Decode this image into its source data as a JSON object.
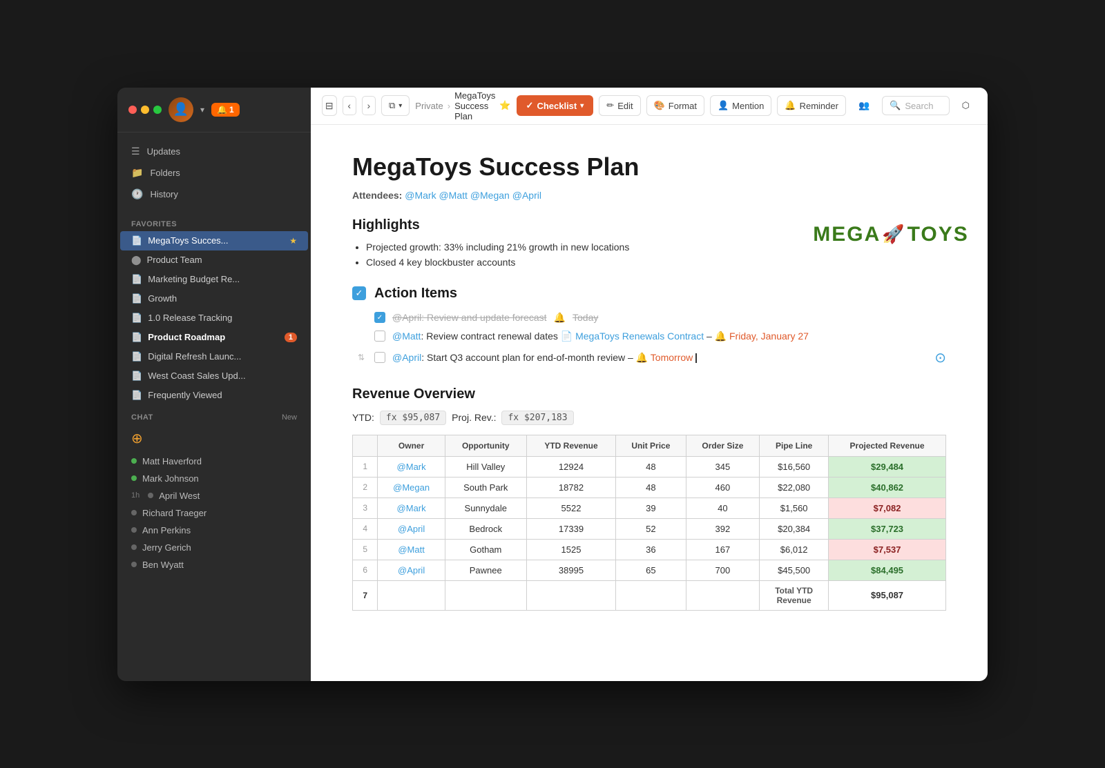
{
  "window": {
    "title": "MegaToys Success Plan",
    "breadcrumb_pre": "Private",
    "breadcrumb_sep": "›",
    "breadcrumb_title": "MegaToys Success Plan",
    "star": "⭐"
  },
  "topbar": {
    "sidebar_toggle": "☰",
    "nav_back": "‹",
    "nav_forward": "›",
    "copy_icon": "⧉",
    "checklist_label": "Checklist",
    "checklist_icon": "✓",
    "edit_label": "Edit",
    "edit_icon": "✏",
    "format_label": "Format",
    "format_icon": "🎨",
    "mention_label": "Mention",
    "mention_icon": "👤",
    "reminder_label": "Reminder",
    "reminder_icon": "🔔",
    "collab_icon": "👥",
    "search_label": "Search",
    "search_icon": "🔍",
    "open_icon": "⬡"
  },
  "sidebar": {
    "notification_count": "1",
    "nav": [
      {
        "icon": "☰",
        "label": "Updates"
      },
      {
        "icon": "📁",
        "label": "Folders"
      },
      {
        "icon": "🕐",
        "label": "History"
      }
    ],
    "favorites_label": "Favorites",
    "favorites": [
      {
        "icon": "📄",
        "label": "MegaToys Succes...",
        "active": true,
        "star": true
      },
      {
        "icon": "⬤",
        "label": "Product Team",
        "active": false
      },
      {
        "icon": "📄",
        "label": "Marketing Budget Re...",
        "active": false
      },
      {
        "icon": "📄",
        "label": "Growth",
        "active": false
      },
      {
        "icon": "📄",
        "label": "1.0 Release Tracking",
        "active": false
      },
      {
        "icon": "📄",
        "label": "Product Roadmap",
        "active": false,
        "badge": "1"
      },
      {
        "icon": "📄",
        "label": "Digital Refresh Launc...",
        "active": false
      },
      {
        "icon": "📄",
        "label": "West Coast Sales Upd...",
        "active": false
      },
      {
        "icon": "📄",
        "label": "Frequently Viewed",
        "active": false
      }
    ],
    "chat_label": "Chat",
    "chat_new": "New",
    "chat_items": [
      {
        "dot": "green",
        "label": "Matt Haverford"
      },
      {
        "dot": "green",
        "label": "Mark Johnson"
      },
      {
        "dot": "grey",
        "label": "April West",
        "time": "1h"
      },
      {
        "dot": "grey",
        "label": "Richard Traeger"
      },
      {
        "dot": "grey",
        "label": "Ann Perkins"
      },
      {
        "dot": "grey",
        "label": "Jerry Gerich"
      },
      {
        "dot": "grey",
        "label": "Ben Wyatt"
      }
    ]
  },
  "document": {
    "title": "MegaToys Success Plan",
    "attendees_label": "Attendees:",
    "attendees": [
      "@Mark",
      "@Matt",
      "@Megan",
      "@April"
    ],
    "highlights_heading": "Highlights",
    "highlights": [
      "Projected growth: 33% including 21% growth in new locations",
      "Closed 4 key blockbuster accounts"
    ],
    "action_items_heading": "Action Items",
    "action_items": [
      {
        "checked": true,
        "strikethrough": true,
        "text": "@April: Review and update forecast",
        "emoji": "🔔",
        "date": "Today",
        "date_style": "strikethrough"
      },
      {
        "checked": false,
        "text": "@Matt: Review contract renewal dates",
        "link_text": "MegaToys Renewals Contract",
        "link_emoji": "📄",
        "dash": "–",
        "emoji": "🔔",
        "date": "Friday, January 27",
        "date_style": "red"
      },
      {
        "checked": false,
        "reorder": true,
        "text": "@April: Start Q3 account plan for end-of-month review –",
        "emoji": "🔔",
        "date": "Tomorrow",
        "date_style": "orange",
        "cursor": true
      }
    ],
    "revenue_heading": "Revenue Overview",
    "ytd_label": "YTD:",
    "ytd_formula": "fx $95,087",
    "proj_label": "Proj. Rev.:",
    "proj_formula": "fx $207,183",
    "table": {
      "headers": [
        "",
        "Owner",
        "Opportunity",
        "YTD Revenue",
        "Unit Price",
        "Order Size",
        "Pipe Line",
        "Projected Revenue"
      ],
      "rows": [
        {
          "num": "1",
          "owner": "@Mark",
          "opp": "Hill Valley",
          "ytd": "12924",
          "unit": "48",
          "order": "345",
          "pipeline": "$16,560",
          "proj": "$29,484",
          "proj_style": "green"
        },
        {
          "num": "2",
          "owner": "@Megan",
          "opp": "South Park",
          "ytd": "18782",
          "unit": "48",
          "order": "460",
          "pipeline": "$22,080",
          "proj": "$40,862",
          "proj_style": "green"
        },
        {
          "num": "3",
          "owner": "@Mark",
          "opp": "Sunnydale",
          "ytd": "5522",
          "unit": "39",
          "order": "40",
          "pipeline": "$1,560",
          "proj": "$7,082",
          "proj_style": "red"
        },
        {
          "num": "4",
          "owner": "@April",
          "opp": "Bedrock",
          "ytd": "17339",
          "unit": "52",
          "order": "392",
          "pipeline": "$20,384",
          "proj": "$37,723",
          "proj_style": "green"
        },
        {
          "num": "5",
          "owner": "@Matt",
          "opp": "Gotham",
          "ytd": "1525",
          "unit": "36",
          "order": "167",
          "pipeline": "$6,012",
          "proj": "$7,537",
          "proj_style": "red"
        },
        {
          "num": "6",
          "owner": "@April",
          "opp": "Pawnee",
          "ytd": "38995",
          "unit": "65",
          "order": "700",
          "pipeline": "$45,500",
          "proj": "$84,495",
          "proj_style": "green"
        },
        {
          "num": "7",
          "owner": "",
          "opp": "",
          "ytd": "",
          "unit": "",
          "order": "",
          "pipeline": "Total YTD Revenue",
          "proj": "$95,087",
          "proj_style": "normal"
        }
      ]
    }
  }
}
